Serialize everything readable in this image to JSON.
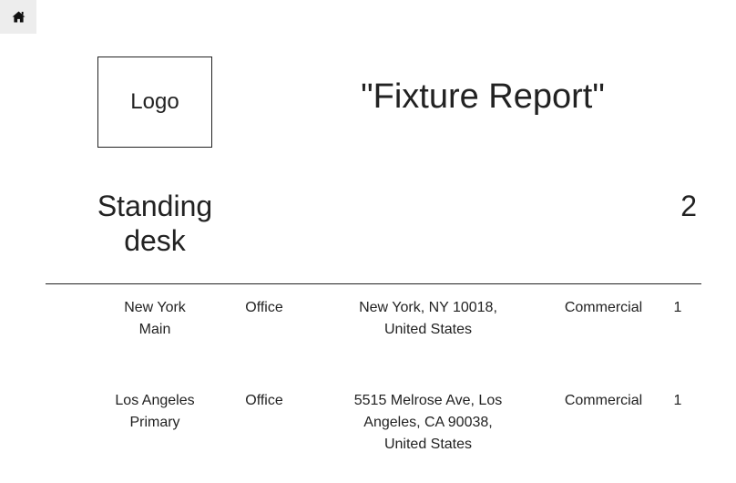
{
  "nav": {
    "home_icon": "home-icon"
  },
  "header": {
    "logo_text": "Logo",
    "title": "\"Fixture Report\""
  },
  "item": {
    "name": "Standing desk",
    "count": "2"
  },
  "rows": [
    {
      "location": "New York Main",
      "type": "Office",
      "address": "New York, NY 10018, United States",
      "category": "Commercial",
      "quantity": "1"
    },
    {
      "location": "Los Angeles Primary",
      "type": "Office",
      "address": "5515 Melrose Ave, Los Angeles, CA 90038, United States",
      "category": "Commercial",
      "quantity": "1"
    }
  ]
}
